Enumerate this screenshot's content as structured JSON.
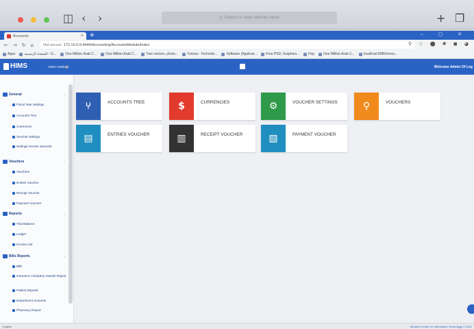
{
  "browser": {
    "search_placeholder": "Search or enter website name",
    "tab_title": "Accounts",
    "url_prefix": "Not secure",
    "url": "172.16.0.9:4444/Accounting/AccountsModule/Index",
    "bookmarks": [
      "Apps",
      "الصفحة الرئيسية - G...",
      "One Million Arab C...",
      "One Million Arab C...",
      "Tree vectors, photo...",
      "Tunisia - Technolo...",
      "Software (Applicat...",
      "Free PSD, Graphics...",
      "Pep",
      "One Million Arab C...",
      "localhost:8080/remo..."
    ]
  },
  "app": {
    "logo_text": "HIMS",
    "admin_settings": "Admin Settings",
    "welcome": "Welcome Admin Of Log"
  },
  "sidebar": {
    "sections": [
      {
        "label": "General",
        "items": [
          "Fiscal Year Settings",
          "Accounts Tree",
          "Currencies",
          "Voucher settings",
          "Settings receive amounts"
        ]
      },
      {
        "label": "Vouchers",
        "items": [
          "Vouchers",
          "Entries Voucher",
          "Receipt Voucher",
          "Payment Voucher"
        ]
      },
      {
        "label": "Reports",
        "items": [
          "Trial Balance",
          "Ledger",
          "Income List"
        ]
      },
      {
        "label": "Bills Reports",
        "items": [
          "Bills",
          "Insurance Company Awards Report",
          "Patient Deposit",
          "Department Amounts",
          "Pharmacy Report"
        ]
      }
    ]
  },
  "cards": [
    {
      "label": "ACCOUNTS TREE",
      "color": "#2f5fb3",
      "icon": "tree-icon"
    },
    {
      "label": "CURRENCIES",
      "color": "#e23b2e",
      "icon": "dollar-icon"
    },
    {
      "label": "VOUCHER SETTINGS",
      "color": "#2e9a4a",
      "icon": "gears-icon"
    },
    {
      "label": "VOUCHERS",
      "color": "#f08a1c",
      "icon": "search-icon"
    },
    {
      "label": "ENTRIES VOUCHER",
      "color": "#1f8fbf",
      "icon": "document-icon"
    },
    {
      "label": "RECEIPT VOUCHER",
      "color": "#333333",
      "icon": "receipt-icon"
    },
    {
      "label": "PAYMENT VOUCHER",
      "color": "#1f8fbf",
      "icon": "money-doc-icon"
    }
  ],
  "status": {
    "language": "English",
    "footer": "AlKafeel Center for Information Technology © 2022"
  }
}
